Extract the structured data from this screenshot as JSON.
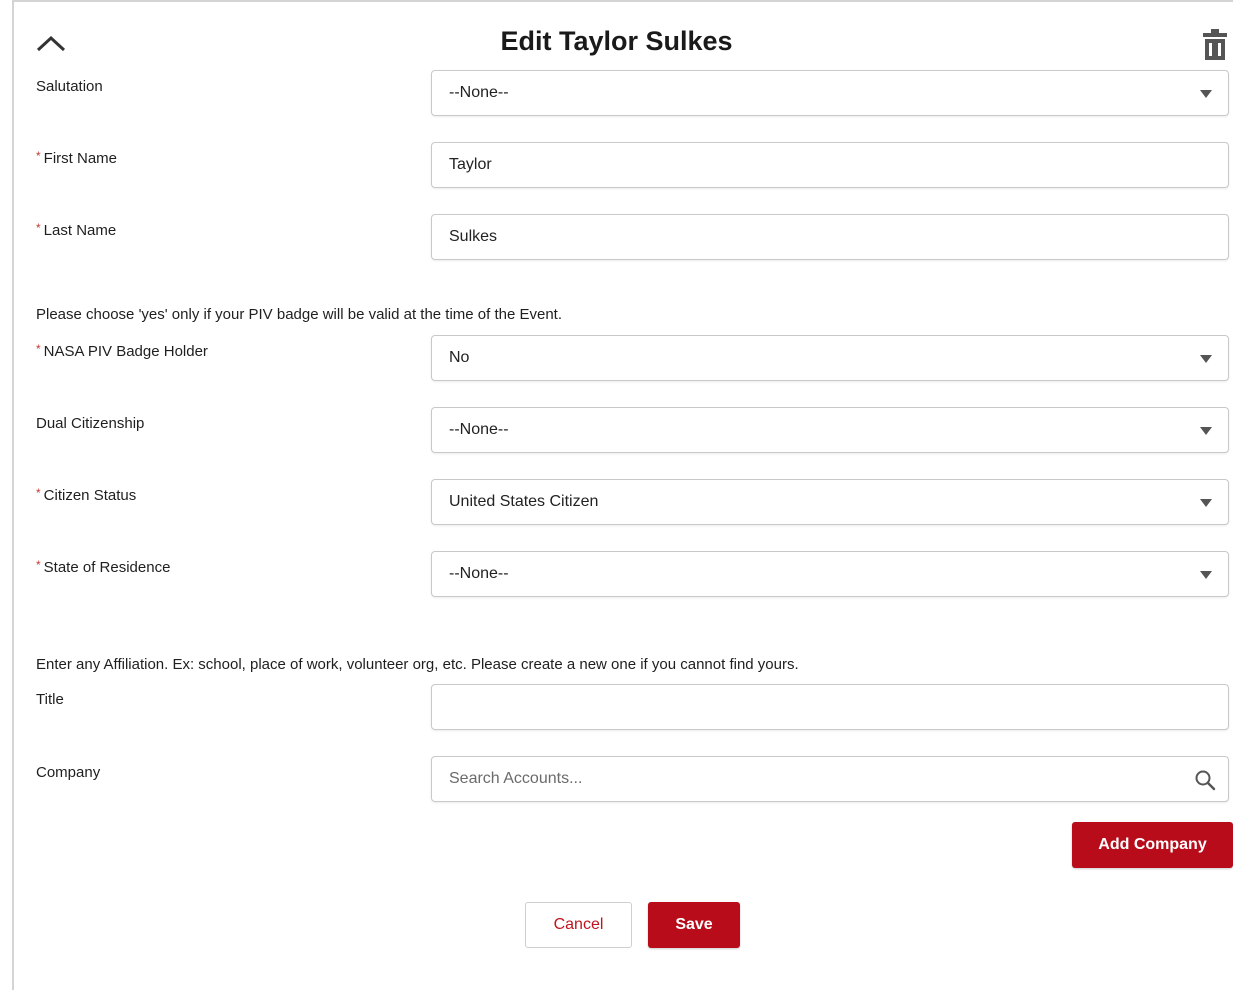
{
  "header": {
    "title": "Edit Taylor Sulkes",
    "collapse_icon": "chevron-up-icon",
    "delete_icon": "trash-icon"
  },
  "fields": {
    "salutation": {
      "label": "Salutation",
      "value": "--None--"
    },
    "first_name": {
      "label": "First Name",
      "value": "Taylor",
      "required_mark": "*"
    },
    "last_name": {
      "label": "Last Name",
      "value": "Sulkes",
      "required_mark": "*"
    },
    "piv_note": "Please choose 'yes' only if your PIV badge will be valid at the time of the Event.",
    "piv_badge": {
      "label": "NASA PIV Badge Holder",
      "value": "No",
      "required_mark": "*"
    },
    "dual_citizenship": {
      "label": "Dual Citizenship",
      "value": "--None--"
    },
    "citizen_status": {
      "label": "Citizen Status",
      "value": "United States Citizen",
      "required_mark": "*"
    },
    "state_of_residence": {
      "label": "State of Residence",
      "value": "--None--",
      "required_mark": "*"
    },
    "affiliation_note": "Enter any Affiliation. Ex: school, place of work, volunteer org, etc. Please create a new one if you cannot find yours.",
    "title": {
      "label": "Title",
      "value": ""
    },
    "company": {
      "label": "Company",
      "placeholder": "Search Accounts..."
    }
  },
  "actions": {
    "add_company": "Add Company",
    "cancel": "Cancel",
    "save": "Save"
  },
  "colors": {
    "primary_red": "#b80c1b",
    "required_red": "#c23934",
    "border_gray": "#c9c9c9"
  }
}
